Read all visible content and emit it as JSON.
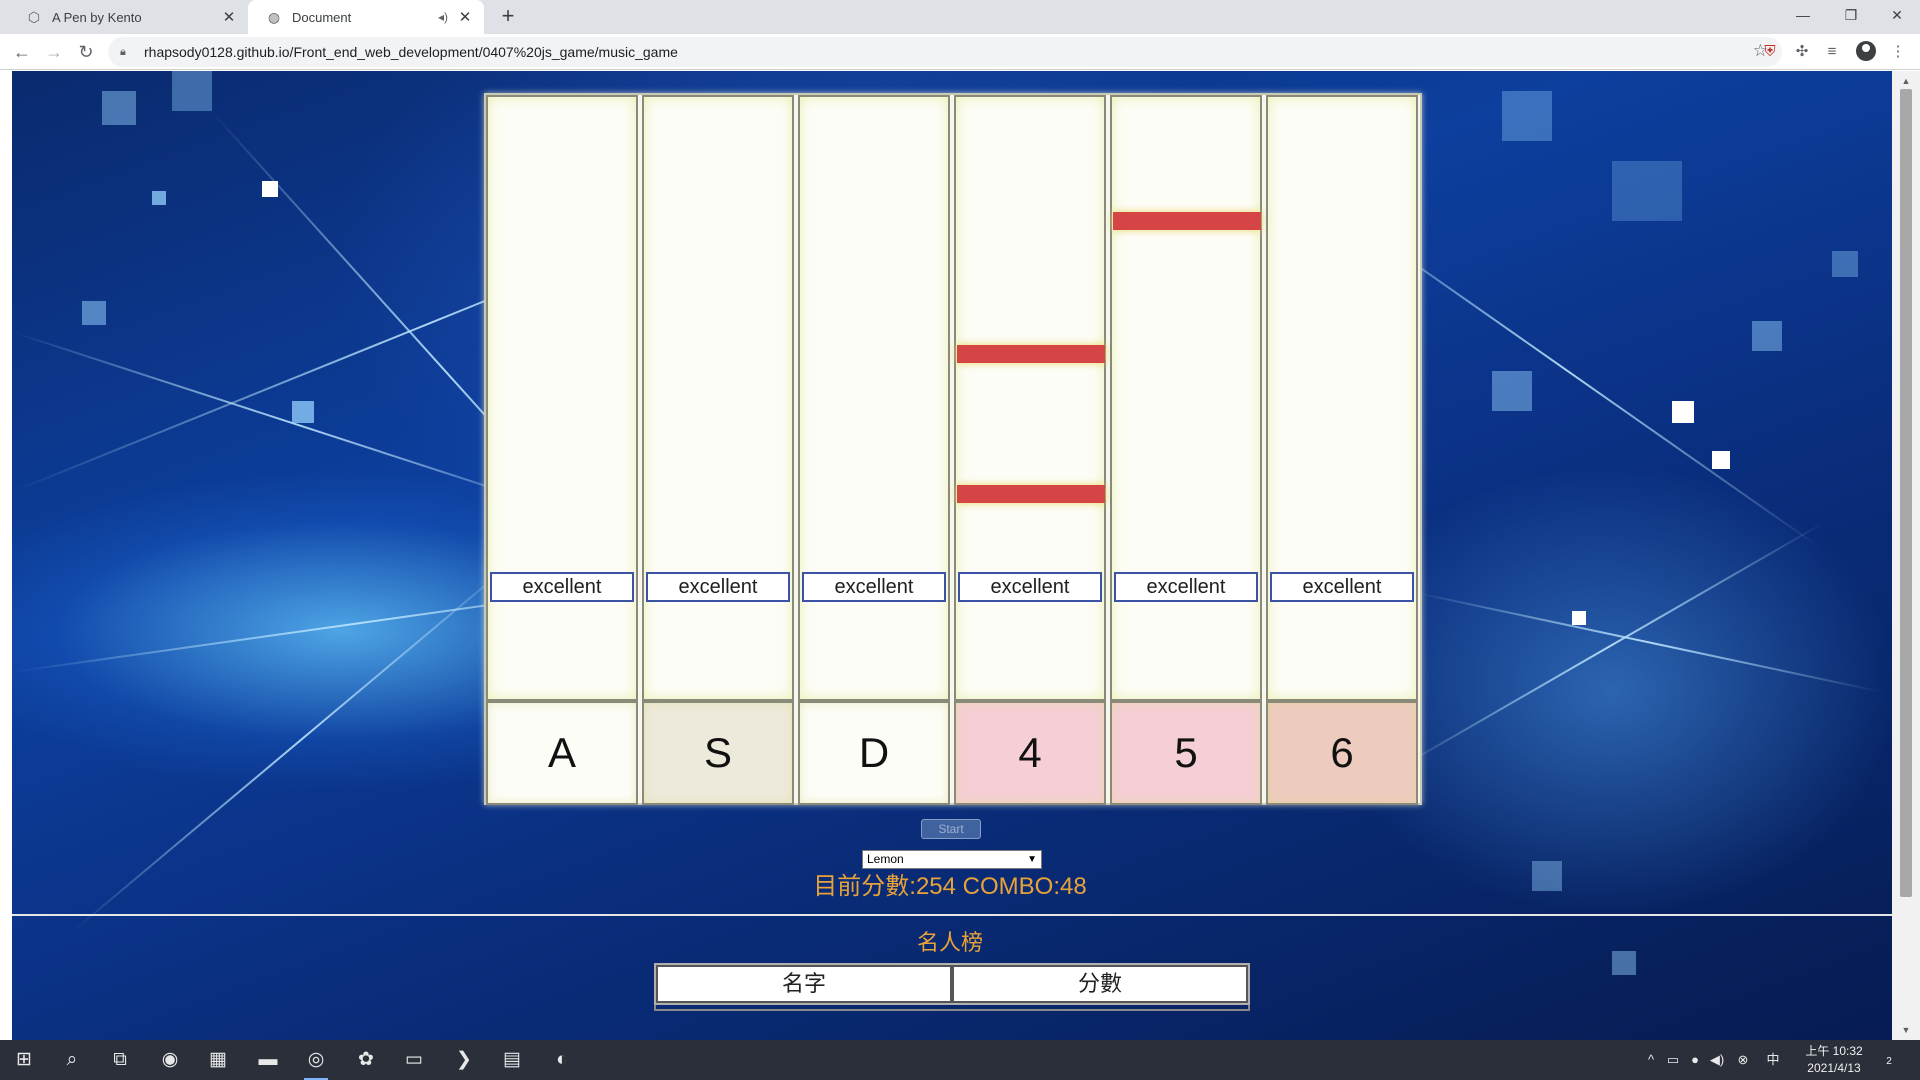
{
  "browser": {
    "tabs": [
      {
        "title": "A Pen by Kento",
        "icon": "codepen-icon",
        "active": false
      },
      {
        "title": "Document",
        "icon": "globe-icon",
        "active": true
      }
    ],
    "url": "rhapsody0128.github.io/Front_end_web_development/0407%20js_game/music_game"
  },
  "game": {
    "lanes": [
      {
        "key": "A",
        "judge": "excellent",
        "key_color": "#fdfdf8",
        "notes": []
      },
      {
        "key": "S",
        "judge": "excellent",
        "key_color": "#eeeadb",
        "notes": []
      },
      {
        "key": "D",
        "judge": "excellent",
        "key_color": "#fdfdf8",
        "notes": []
      },
      {
        "key": "4",
        "judge": "excellent",
        "key_color": "#f6cfd6",
        "notes": [
          0.41,
          0.64
        ]
      },
      {
        "key": "5",
        "judge": "excellent",
        "key_color": "#f6cfd6",
        "notes": [
          0.19
        ]
      },
      {
        "key": "6",
        "judge": "excellent",
        "key_color": "#eecbbf",
        "notes": []
      }
    ],
    "note_color": "#d64545"
  },
  "controls": {
    "start_label": "Start",
    "song_selected": "Lemon",
    "score_text": "目前分數:254 COMBO:48"
  },
  "leaderboard": {
    "title": "名人榜",
    "headers": [
      "名字",
      "分數"
    ]
  },
  "taskbar": {
    "time": "上午 10:32",
    "date": "2021/4/13",
    "notification_count": "2"
  },
  "theme": {
    "accent_text": "#e8a23a",
    "judge_border": "#3c52a6"
  }
}
